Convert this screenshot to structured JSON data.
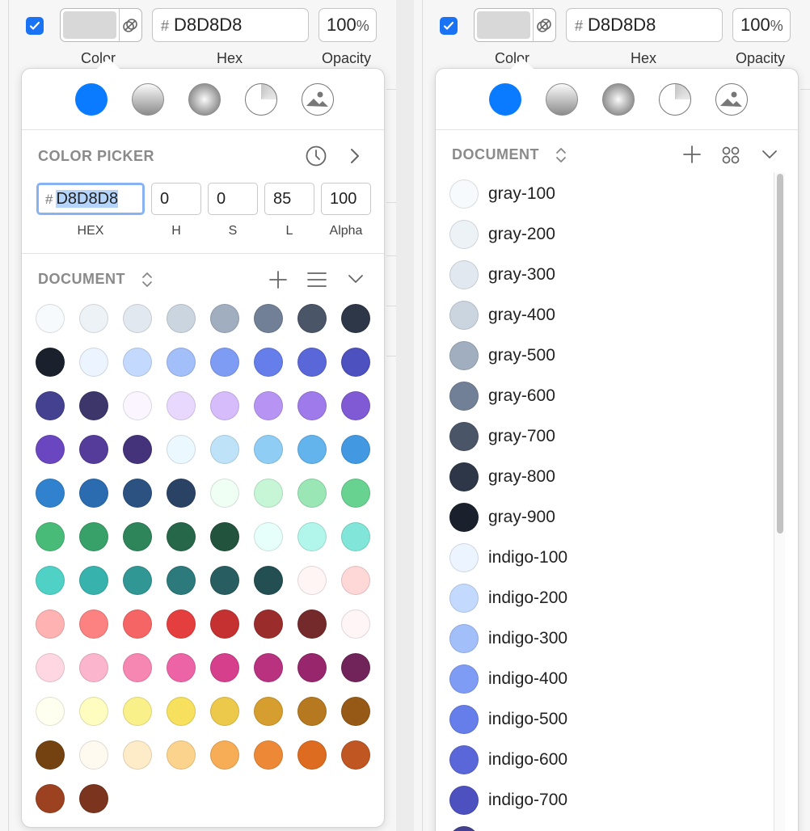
{
  "top_row": {
    "hex_hash": "#",
    "hex_value": "D8D8D8",
    "opacity_value": "100",
    "opacity_unit": "%",
    "label_color": "Color",
    "label_hex": "Hex",
    "label_opacity": "Opacity",
    "swatch_color": "#d8d8d8"
  },
  "fill_types": [
    "solid",
    "linear-gradient",
    "radial-gradient",
    "angular-gradient",
    "image"
  ],
  "picker": {
    "title": "COLOR PICKER",
    "hex_hash": "#",
    "hex": "D8D8D8",
    "h": "0",
    "s": "0",
    "l": "85",
    "alpha": "100",
    "labels": {
      "hex": "HEX",
      "h": "H",
      "s": "S",
      "l": "L",
      "alpha": "Alpha"
    }
  },
  "document": {
    "title": "DOCUMENT",
    "grid_colors": [
      "#f7fafc",
      "#edf2f7",
      "#e2e8f0",
      "#cbd5e0",
      "#a0aec0",
      "#718096",
      "#4a5568",
      "#2d3748",
      "#1a202c",
      "#ebf4ff",
      "#c3dafe",
      "#a3bffa",
      "#7f9cf5",
      "#667eea",
      "#5a67d8",
      "#4c51bf",
      "#434190",
      "#3c366b",
      "#faf5ff",
      "#e9d8fd",
      "#d6bcfa",
      "#b794f4",
      "#9f7aea",
      "#805ad5",
      "#6b46c1",
      "#553c9a",
      "#44337a",
      "#ebf8ff",
      "#bee3f8",
      "#90cdf4",
      "#63b3ed",
      "#4299e1",
      "#3182ce",
      "#2b6cb0",
      "#2c5282",
      "#2a4365",
      "#f0fff4",
      "#c6f6d5",
      "#9ae6b4",
      "#68d391",
      "#48bb78",
      "#38a169",
      "#2f855a",
      "#276749",
      "#22543d",
      "#e6fffa",
      "#b2f5ea",
      "#81e6d9",
      "#4fd1c5",
      "#38b2ac",
      "#319795",
      "#2c7a7b",
      "#285e61",
      "#234e52",
      "#fff5f5",
      "#fed7d7",
      "#feb2b2",
      "#fc8181",
      "#f56565",
      "#e53e3e",
      "#c53030",
      "#9b2c2c",
      "#742a2a",
      "#fff5f7",
      "#fed7e2",
      "#fbb6ce",
      "#f687b3",
      "#ed64a6",
      "#d53f8c",
      "#b83280",
      "#97266d",
      "#702459",
      "#fffff0",
      "#fefcbf",
      "#faf089",
      "#f6e05e",
      "#ecc94b",
      "#d69e2e",
      "#b7791f",
      "#975a16",
      "#744210",
      "#fffaf0",
      "#feebc8",
      "#fbd38d",
      "#f6ad55",
      "#ed8936",
      "#dd6b20",
      "#c05621",
      "#9c4221",
      "#7b341e"
    ],
    "list_items": [
      {
        "name": "gray-100",
        "color": "#f7fafc"
      },
      {
        "name": "gray-200",
        "color": "#edf2f7"
      },
      {
        "name": "gray-300",
        "color": "#e2e8f0"
      },
      {
        "name": "gray-400",
        "color": "#cbd5e0"
      },
      {
        "name": "gray-500",
        "color": "#a0aec0"
      },
      {
        "name": "gray-600",
        "color": "#718096"
      },
      {
        "name": "gray-700",
        "color": "#4a5568"
      },
      {
        "name": "gray-800",
        "color": "#2d3748"
      },
      {
        "name": "gray-900",
        "color": "#1a202c"
      },
      {
        "name": "indigo-100",
        "color": "#ebf4ff"
      },
      {
        "name": "indigo-200",
        "color": "#c3dafe"
      },
      {
        "name": "indigo-300",
        "color": "#a3bffa"
      },
      {
        "name": "indigo-400",
        "color": "#7f9cf5"
      },
      {
        "name": "indigo-500",
        "color": "#667eea"
      },
      {
        "name": "indigo-600",
        "color": "#5a67d8"
      },
      {
        "name": "indigo-700",
        "color": "#4c51bf"
      },
      {
        "name": "",
        "color": "#434190"
      }
    ]
  }
}
